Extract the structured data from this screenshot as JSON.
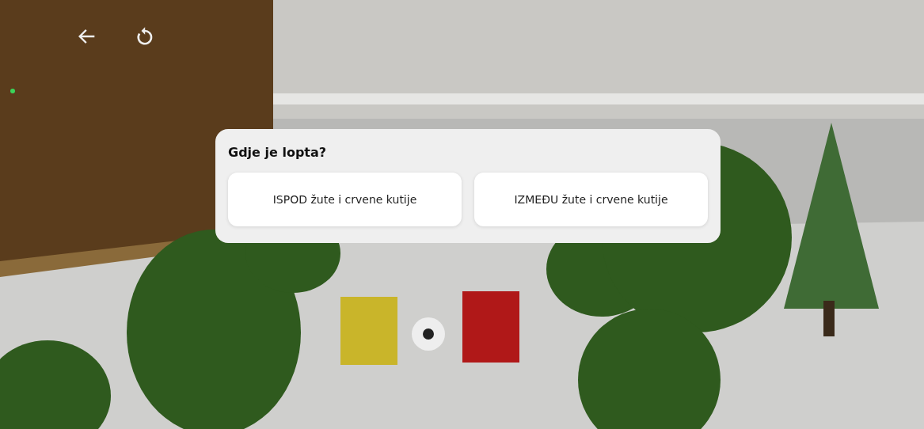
{
  "question": {
    "title": "Gdje je lopta?",
    "answers": [
      {
        "label": "ISPOD žute i crvene kutije",
        "selected": false
      },
      {
        "label": "IZMEĐU žute i crvene kutije",
        "selected": false
      }
    ]
  }
}
